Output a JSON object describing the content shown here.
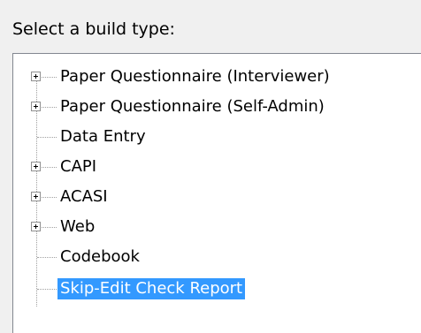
{
  "dialog": {
    "prompt": "Select a build type:"
  },
  "build_types": [
    {
      "label": "Paper Questionnaire (Interviewer)",
      "expandable": true,
      "selected": false
    },
    {
      "label": "Paper Questionnaire (Self-Admin)",
      "expandable": true,
      "selected": false
    },
    {
      "label": "Data Entry",
      "expandable": false,
      "selected": false
    },
    {
      "label": "CAPI",
      "expandable": true,
      "selected": false
    },
    {
      "label": "ACASI",
      "expandable": true,
      "selected": false
    },
    {
      "label": "Web",
      "expandable": true,
      "selected": false
    },
    {
      "label": "Codebook",
      "expandable": false,
      "selected": false
    },
    {
      "label": "Skip-Edit Check Report",
      "expandable": false,
      "selected": true
    }
  ],
  "colors": {
    "selection_background": "#3399ff",
    "selection_text": "#ffffff",
    "tree_border": "#828790"
  }
}
